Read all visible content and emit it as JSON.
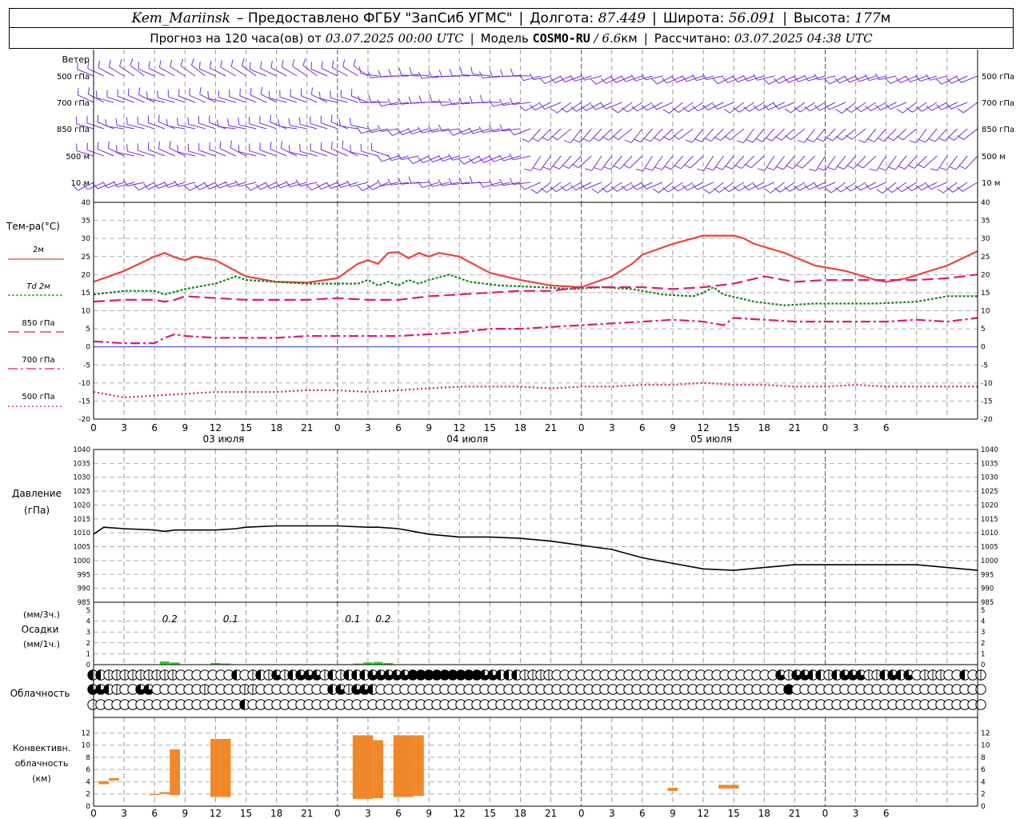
{
  "header": {
    "station": "Kem_Mariinsk",
    "provider": "– Предоставлено ФГБУ \"ЗапСиб УГМС\"",
    "lon_label": "Долгота:",
    "lon_value": "87.449",
    "lat_label": "Широта:",
    "lat_value": "56.091",
    "alt_label": "Высота:",
    "alt_value": "177",
    "alt_unit": "м",
    "forecast_label": "Прогноз на 120 часа(ов) от",
    "forecast_start": "03.07.2025 00:00 UTC",
    "model_label": "Модель",
    "model_name": "COSMO-RU",
    "model_res": "/ 6.6",
    "model_res_unit": "км",
    "calc_label": "Рассчитано:",
    "calc_time": "03.07.2025 04:38 UTC"
  },
  "colors": {
    "t2m": "#e8453c",
    "td2m": "#138a13",
    "t850": "#e0197a",
    "t700": "#e0197a",
    "t500": "#e0197a",
    "wind": "#7a2ad6",
    "precip": "#2ecc2e",
    "convective": "#f0882a",
    "zero_line": "#3b3bd6",
    "pressure": "#000000"
  },
  "chart_data": [
    {
      "type": "wind_barbs",
      "label": "Ветер",
      "levels": [
        "500 гПа",
        "700 гПа",
        "850 гПа",
        "500 м",
        "10 м"
      ],
      "x_hours": [
        0,
        120
      ]
    },
    {
      "type": "line",
      "label": "Тем-ра(°C)",
      "ylim": [
        -20,
        40
      ],
      "yticks": [
        -20,
        -15,
        -10,
        -5,
        0,
        5,
        10,
        15,
        20,
        25,
        30,
        35,
        40
      ],
      "xticks": [
        "0",
        "3",
        "6",
        "9",
        "12",
        "15",
        "18",
        "21",
        "0",
        "3",
        "6",
        "9",
        "12",
        "15",
        "18",
        "21",
        "0",
        "3",
        "6",
        "9",
        "12",
        "15",
        "18",
        "21",
        "0",
        "3",
        "6"
      ],
      "day_labels": [
        {
          "hour": 12,
          "text": "03 июля"
        },
        {
          "hour": 36,
          "text": "04 июля"
        },
        {
          "hour": 60,
          "text": "05 июля"
        }
      ],
      "series": [
        {
          "name": "2м",
          "key": "t2m",
          "x": [
            0,
            3,
            6,
            7,
            8,
            9,
            10,
            12,
            15,
            18,
            21,
            24,
            26,
            27,
            28,
            29,
            30,
            31,
            32,
            33,
            34,
            36,
            39,
            42,
            45,
            48,
            51,
            53,
            54,
            57,
            60,
            63,
            64,
            65,
            68,
            71,
            74,
            77,
            78,
            80,
            84,
            87
          ],
          "y": [
            18,
            21,
            25,
            26,
            24.8,
            24,
            25,
            24,
            19.5,
            18,
            17.8,
            19,
            23,
            24,
            23,
            26,
            26.2,
            24.5,
            26,
            25,
            26,
            25,
            20.5,
            18.5,
            17,
            16.5,
            19.5,
            23,
            25.5,
            28.5,
            30.8,
            30.8,
            30,
            28.5,
            26,
            22.5,
            21,
            18.5,
            18,
            19,
            22.5,
            26.5
          ]
        },
        {
          "name": "Td 2м",
          "key": "td2m",
          "x": [
            0,
            3,
            6,
            7,
            9,
            12,
            14,
            15,
            18,
            21,
            24,
            26,
            27,
            28,
            29,
            30,
            31,
            32,
            33,
            35,
            37,
            40,
            44,
            47,
            50,
            53,
            56,
            59,
            60,
            61,
            62,
            65,
            68,
            71,
            72,
            74,
            77,
            81,
            84,
            87
          ],
          "y": [
            14.5,
            15.5,
            15.5,
            14.5,
            16,
            17.5,
            19.5,
            18.5,
            18,
            17.5,
            17.5,
            17.5,
            18.5,
            17,
            18,
            17,
            18.5,
            17.5,
            18.5,
            20,
            18,
            17,
            16.5,
            16,
            16.5,
            16,
            14.5,
            14,
            15,
            16.5,
            14.5,
            12.5,
            11.5,
            12,
            12,
            12,
            12,
            12.5,
            14,
            14
          ]
        },
        {
          "name": "850 гПа",
          "key": "t850",
          "x": [
            0,
            3,
            6,
            7,
            8,
            9,
            12,
            15,
            18,
            21,
            24,
            27,
            30,
            33,
            36,
            39,
            42,
            45,
            48,
            51,
            54,
            57,
            60,
            63,
            66,
            69,
            72,
            75,
            78,
            81,
            84,
            87
          ],
          "y": [
            12.5,
            13,
            13,
            12.5,
            13,
            14,
            13.5,
            13,
            13,
            13,
            13.5,
            13,
            13,
            14,
            14.5,
            15,
            15.5,
            15.5,
            16.5,
            16.5,
            16.5,
            16,
            16.5,
            17.5,
            19.5,
            18,
            18.5,
            18.5,
            18.5,
            18.5,
            19,
            20
          ]
        },
        {
          "name": "700 гПа",
          "key": "t700",
          "x": [
            0,
            3,
            6,
            7,
            8,
            9,
            12,
            15,
            18,
            21,
            24,
            27,
            30,
            33,
            36,
            39,
            42,
            45,
            48,
            51,
            54,
            57,
            60,
            61,
            62,
            63,
            66,
            69,
            72,
            75,
            78,
            81,
            84,
            87
          ],
          "y": [
            1.5,
            1,
            1,
            2.5,
            3.5,
            3,
            2.5,
            2.5,
            2.5,
            3,
            3,
            3,
            3,
            3.5,
            4,
            5,
            5,
            5.5,
            6,
            6.5,
            7,
            7.5,
            7,
            6.5,
            6,
            8,
            7.5,
            7,
            7,
            7,
            7,
            7.5,
            7,
            8
          ]
        },
        {
          "name": "500 гПа",
          "key": "t500",
          "x": [
            0,
            3,
            6,
            9,
            12,
            15,
            18,
            21,
            24,
            27,
            30,
            33,
            36,
            39,
            42,
            45,
            48,
            51,
            54,
            57,
            60,
            63,
            66,
            69,
            72,
            75,
            78,
            81,
            84,
            87
          ],
          "y": [
            -12.5,
            -14,
            -13.5,
            -13,
            -12.5,
            -12.5,
            -12.5,
            -12,
            -12,
            -12.5,
            -12,
            -11.5,
            -11,
            -11,
            -11,
            -11.5,
            -11,
            -11,
            -10.5,
            -10.5,
            -10,
            -10.5,
            -10.5,
            -11,
            -11,
            -10.5,
            -11,
            -11,
            -11,
            -11
          ]
        }
      ]
    },
    {
      "type": "line",
      "label": "Давление",
      "unit": "(гПа)",
      "ylim": [
        985,
        1040
      ],
      "yticks": [
        985,
        990,
        995,
        1000,
        1005,
        1010,
        1015,
        1020,
        1025,
        1030,
        1035,
        1040
      ],
      "series": [
        {
          "name": "Давление",
          "key": "pressure",
          "x": [
            0,
            1,
            3,
            6,
            7,
            8,
            9,
            12,
            14,
            15,
            18,
            21,
            24,
            27,
            28,
            30,
            33,
            36,
            39,
            42,
            45,
            48,
            51,
            54,
            57,
            60,
            63,
            66,
            69,
            72,
            75,
            78,
            81,
            84,
            87
          ],
          "y": [
            1009.5,
            1012,
            1011.5,
            1011,
            1010.5,
            1011,
            1011,
            1011,
            1011.5,
            1012,
            1012.5,
            1012.5,
            1012.5,
            1012,
            1012,
            1011.5,
            1009.5,
            1008.5,
            1008.5,
            1008,
            1007,
            1005.5,
            1004,
            1001,
            999,
            997,
            996.5,
            997.5,
            998.5,
            998.5,
            998.5,
            998.5,
            998.5,
            997.5,
            996.5
          ]
        }
      ]
    },
    {
      "type": "bar",
      "label": "Осадки",
      "unit_3h": "(мм/3ч.)",
      "unit_1h": "(мм/1ч.)",
      "ylim": [
        0,
        5
      ],
      "yticks": [
        0,
        1,
        2,
        3,
        4,
        5
      ],
      "annotations": [
        {
          "hour": 7.5,
          "text": "0.2"
        },
        {
          "hour": 13.5,
          "text": "0.1"
        },
        {
          "hour": 25.5,
          "text": "0.1"
        },
        {
          "hour": 28.5,
          "text": "0.2"
        }
      ],
      "hours": [
        7,
        8,
        12,
        13,
        26,
        27,
        28,
        29
      ],
      "values": [
        0.3,
        0.2,
        0.15,
        0.1,
        0.1,
        0.2,
        0.25,
        0.15
      ]
    },
    {
      "type": "cloud_cover",
      "label": "Облачность",
      "encoding": "0=clear,1=1/4,2=1/2,3=3/4,4=overcast",
      "rows": [
        "2211111111100000002012131233312122233333444444444332221111000000000000000000000000000031332212333112323011100201",
        "3321003300000010000110000000002313320000000000000000000000000000000000000000000000000004000000000000000000000000",
        "0000000000000000000200000000000000000000000000000000000000000000000000000000000000000000000000000000000000000000"
      ]
    },
    {
      "type": "bar",
      "label": "Конвективн. облачность",
      "unit": "(км)",
      "ylim": [
        0,
        14
      ],
      "yticks": [
        0,
        2,
        4,
        6,
        8,
        10,
        12
      ],
      "bars": [
        {
          "h0": 0.5,
          "h1": 1.5,
          "base": 3.6,
          "top": 4.1
        },
        {
          "h0": 1.5,
          "h1": 2.5,
          "base": 4.2,
          "top": 4.6
        },
        {
          "h0": 5.5,
          "h1": 6.5,
          "base": 1.8,
          "top": 2.0
        },
        {
          "h0": 6.5,
          "h1": 7.5,
          "base": 2.0,
          "top": 2.3
        },
        {
          "h0": 7.5,
          "h1": 8.5,
          "base": 1.8,
          "top": 9.3
        },
        {
          "h0": 11.5,
          "h1": 12.5,
          "base": 1.5,
          "top": 11.0
        },
        {
          "h0": 12.5,
          "h1": 13.5,
          "base": 1.5,
          "top": 11.0
        },
        {
          "h0": 25.5,
          "h1": 27.5,
          "base": 1.2,
          "top": 11.6
        },
        {
          "h0": 27.5,
          "h1": 28.5,
          "base": 1.3,
          "top": 10.8
        },
        {
          "h0": 29.5,
          "h1": 31.5,
          "base": 1.5,
          "top": 11.6
        },
        {
          "h0": 31.5,
          "h1": 32.5,
          "base": 1.7,
          "top": 11.6
        },
        {
          "h0": 56.5,
          "h1": 57.5,
          "base": 2.5,
          "top": 3.0
        },
        {
          "h0": 61.5,
          "h1": 63.5,
          "base": 2.9,
          "top": 3.5
        }
      ]
    }
  ]
}
